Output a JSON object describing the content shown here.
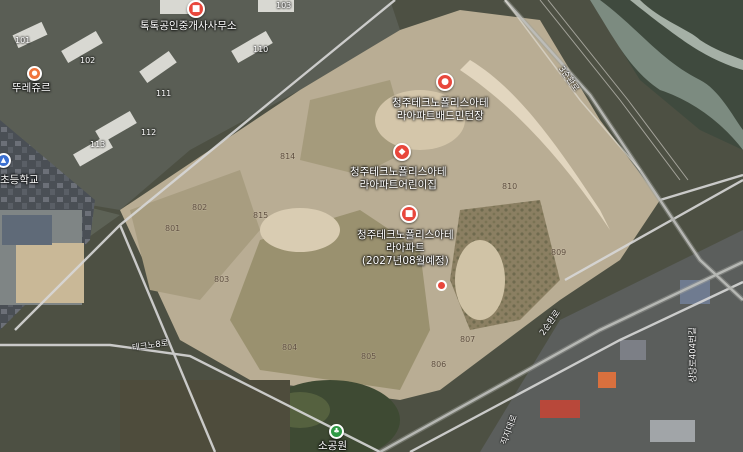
{
  "map": {
    "colors": {
      "poi_red": "#e8473c",
      "poi_orange": "#f0743c",
      "poi_blue": "#3b6fd0",
      "poi_green": "#2f9a45",
      "road_line": "#d8d8d8"
    },
    "pois": [
      {
        "label": "톡톡공인중개사사무소",
        "icon": "shop-icon"
      },
      {
        "label": "뚜레쥬르",
        "icon": "bakery-icon"
      },
      {
        "label": "초등학교",
        "icon": "school-icon"
      },
      {
        "label_lines": [
          "청주테크노폴리스아테",
          "라아파트배드민턴장"
        ],
        "icon": "sports-icon"
      },
      {
        "label_lines": [
          "청주테크노폴리스아테",
          "라아파트어린이집"
        ],
        "icon": "kindergarten-icon"
      },
      {
        "label_lines": [
          "청주테크노폴리스아테",
          "라아파트",
          "(2027년08월예정)"
        ],
        "icon": "apartment-icon"
      },
      {
        "label": "",
        "icon": "location-dot"
      },
      {
        "label": "소공원",
        "icon": "park-icon"
      }
    ],
    "buildings": [
      "103",
      "101",
      "102",
      "110",
      "111",
      "112",
      "113"
    ],
    "lots": [
      "814",
      "802",
      "801",
      "815",
      "803",
      "810",
      "809",
      "804",
      "805",
      "806",
      "807"
    ],
    "roads": [
      "테크노8로",
      "2순환로",
      "3순환로",
      "상당로404번길",
      "직지대로"
    ]
  }
}
